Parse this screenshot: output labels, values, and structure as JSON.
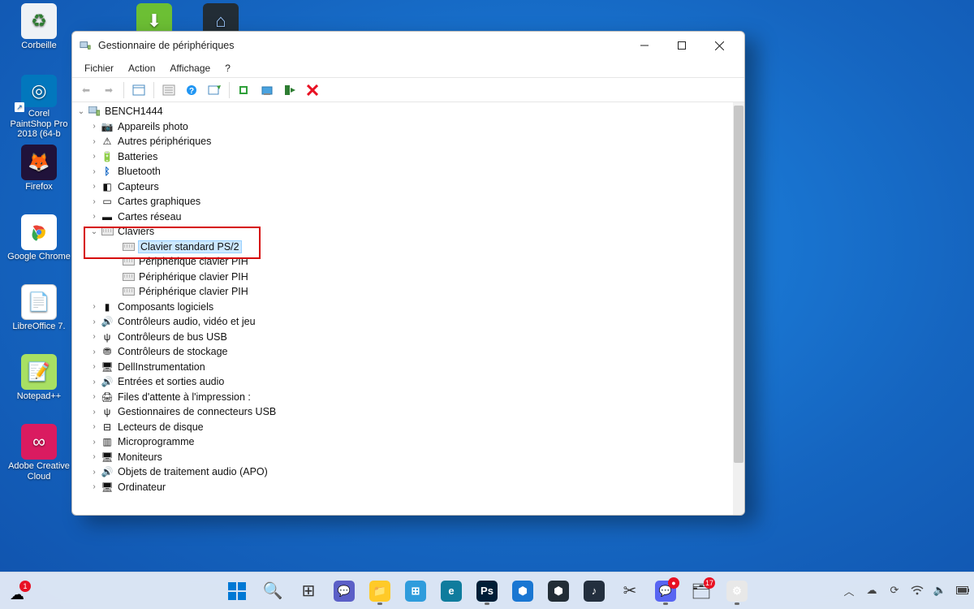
{
  "desktop": {
    "icons": [
      {
        "label": "Corbeille",
        "cls": "ic-recycle",
        "glyph": "♻"
      },
      {
        "label": "",
        "cls": "ic-green",
        "glyph": "⬇"
      },
      {
        "label": "",
        "cls": "ic-dark",
        "glyph": "⌂"
      },
      {
        "label": "Corel PaintShop Pro 2018 (64-b",
        "cls": "ic-psp",
        "glyph": "◎"
      },
      {
        "label": "Firefox",
        "cls": "ic-ff",
        "glyph": "🦊"
      },
      {
        "label": "Google Chrome",
        "cls": "ic-gc",
        "glyph": "◉"
      },
      {
        "label": "LibreOffice 7.",
        "cls": "ic-lo",
        "glyph": "𐐋"
      },
      {
        "label": "Notepad++",
        "cls": "ic-np",
        "glyph": "N"
      },
      {
        "label": "Adobe Creative Cloud",
        "cls": "ic-cc",
        "glyph": "∞"
      }
    ]
  },
  "window": {
    "title": "Gestionnaire de périphériques",
    "menu": [
      "Fichier",
      "Action",
      "Affichage",
      "?"
    ],
    "root": "BENCH1444",
    "categories": [
      {
        "label": "Appareils photo",
        "icon": "📷"
      },
      {
        "label": "Autres périphériques",
        "icon": "⚠"
      },
      {
        "label": "Batteries",
        "icon": "🔋"
      },
      {
        "label": "Bluetooth",
        "icon": "ᛒ",
        "blue": true
      },
      {
        "label": "Capteurs",
        "icon": "◧"
      },
      {
        "label": "Cartes graphiques",
        "icon": "▭"
      },
      {
        "label": "Cartes réseau",
        "icon": "▬"
      }
    ],
    "keyboard_cat": "Claviers",
    "keyboard_children": [
      "Clavier standard PS/2",
      "Périphérique clavier PIH",
      "Périphérique clavier PIH",
      "Périphérique clavier PIH"
    ],
    "categories2": [
      {
        "label": "Composants logiciels",
        "icon": "▮"
      },
      {
        "label": "Contrôleurs audio, vidéo et jeu",
        "icon": "🔊"
      },
      {
        "label": "Contrôleurs de bus USB",
        "icon": "ψ"
      },
      {
        "label": "Contrôleurs de stockage",
        "icon": "⛃"
      },
      {
        "label": "DellInstrumentation",
        "icon": "🖥"
      },
      {
        "label": "Entrées et sorties audio",
        "icon": "🔊"
      },
      {
        "label": "Files d'attente à l'impression :",
        "icon": "🖨"
      },
      {
        "label": "Gestionnaires de connecteurs USB",
        "icon": "ψ"
      },
      {
        "label": "Lecteurs de disque",
        "icon": "⊟"
      },
      {
        "label": "Microprogramme",
        "icon": "▥"
      },
      {
        "label": "Moniteurs",
        "icon": "🖥"
      },
      {
        "label": "Objets de traitement audio (APO)",
        "icon": "🔊"
      },
      {
        "label": "Ordinateur",
        "icon": "🖥"
      }
    ]
  },
  "taskbar": {
    "weather_badge": "1",
    "apps": [
      {
        "name": "start",
        "glyph": "",
        "bg": ""
      },
      {
        "name": "search",
        "glyph": "🔍",
        "bg": ""
      },
      {
        "name": "taskview",
        "glyph": "⊞",
        "bg": ""
      },
      {
        "name": "chat",
        "glyph": "💬",
        "bg": "#5b5fc7"
      },
      {
        "name": "explorer",
        "glyph": "📁",
        "bg": "#ffca28",
        "running": true
      },
      {
        "name": "store",
        "glyph": "⊞",
        "bg": "#2f9cdc"
      },
      {
        "name": "edge",
        "glyph": "e",
        "bg": "#0f7c9d"
      },
      {
        "name": "photoshop",
        "glyph": "Ps",
        "bg": "#001e36",
        "running": true
      },
      {
        "name": "hex1",
        "glyph": "⬢",
        "bg": "#1976d2"
      },
      {
        "name": "hex2",
        "glyph": "⬢",
        "bg": "#222d36"
      },
      {
        "name": "amazon-music",
        "glyph": "♪",
        "bg": "#232f3e"
      },
      {
        "name": "snip",
        "glyph": "✂",
        "bg": ""
      },
      {
        "name": "discord",
        "glyph": "💬",
        "bg": "#5865f2",
        "running": true,
        "badge": "●"
      },
      {
        "name": "office",
        "glyph": "🗂",
        "bg": "",
        "badge": "17"
      },
      {
        "name": "devmgr",
        "glyph": "⚙",
        "bg": "#e8e8e8",
        "running": true
      }
    ]
  }
}
